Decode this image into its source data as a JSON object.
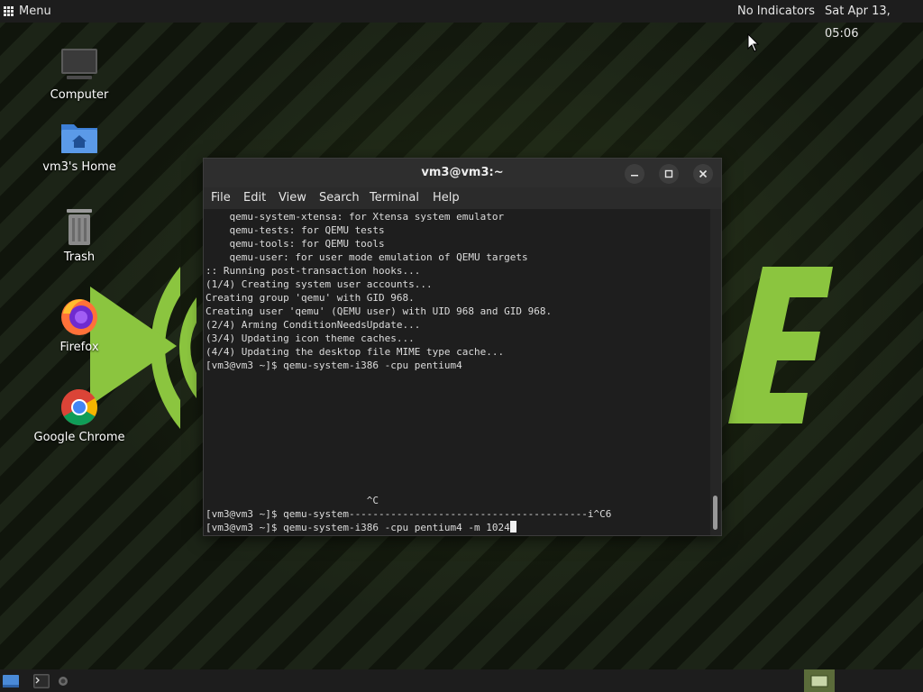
{
  "top_panel": {
    "menu_label": "Menu",
    "indicators_label": "No Indicators",
    "clock": "Sat Apr 13, 05:06"
  },
  "desktop_icons": [
    {
      "label": "Computer",
      "icon": "computer-icon"
    },
    {
      "label": "vm3's Home",
      "icon": "home-folder-icon"
    },
    {
      "label": "Trash",
      "icon": "trash-icon"
    },
    {
      "label": "Firefox",
      "icon": "firefox-icon"
    },
    {
      "label": "Google Chrome",
      "icon": "chrome-icon"
    }
  ],
  "terminal": {
    "title": "vm3@vm3:~",
    "menu": [
      "File",
      "Edit",
      "View",
      "Search",
      "Terminal",
      "Help"
    ],
    "lines": [
      "    qemu-system-xtensa: for Xtensa system emulator",
      "    qemu-tests: for QEMU tests",
      "    qemu-tools: for QEMU tools",
      "    qemu-user: for user mode emulation of QEMU targets",
      ":: Running post-transaction hooks...",
      "(1/4) Creating system user accounts...",
      "Creating group 'qemu' with GID 968.",
      "Creating user 'qemu' (QEMU user) with UID 968 and GID 968.",
      "(2/4) Arming ConditionNeedsUpdate...",
      "(3/4) Updating icon theme caches...",
      "(4/4) Updating the desktop file MIME type cache...",
      "[vm3@vm3 ~]$ qemu-system-i386 -cpu pentium4"
    ],
    "ctrl_c_line": "                           ^C",
    "prompt_line_1": "[vm3@vm3 ~]$ qemu-system----------------------------------------i^C6",
    "prompt_line_2": "[vm3@vm3 ~]$ qemu-system-i386 -cpu pentium4 -m 1024"
  },
  "colors": {
    "panel_bg": "#1d1d1d",
    "terminal_bg": "#1e1e1e",
    "accent_green": "#8cc63f"
  }
}
